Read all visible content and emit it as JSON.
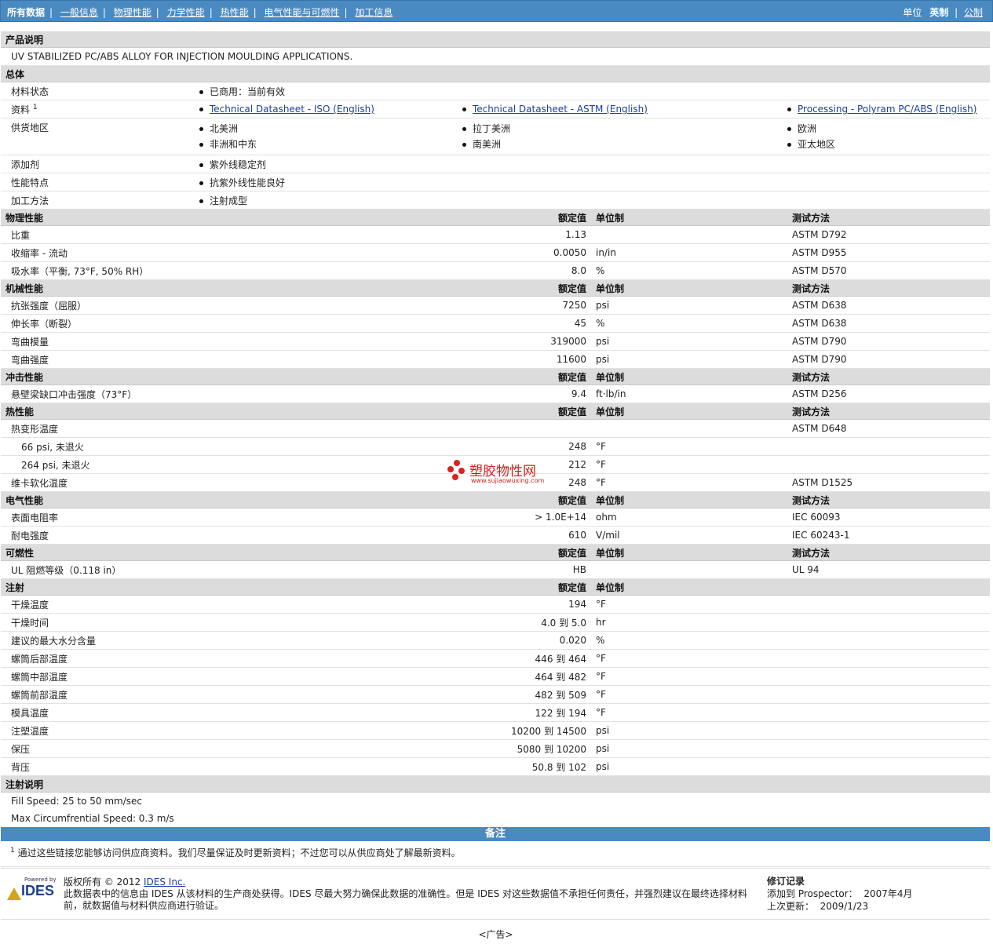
{
  "nav": {
    "tabs": [
      "所有数据",
      "一般信息",
      "物理性能",
      "力学性能",
      "热性能",
      "电气性能与可燃性",
      "加工信息"
    ],
    "units_label": "单位",
    "unit_active": "英制",
    "unit_other": "公制"
  },
  "product": {
    "heading": "产品说明",
    "description": "UV STABILIZED PC/ABS ALLOY FOR INJECTION MOULDING APPLICATIONS."
  },
  "general": {
    "heading": "总体",
    "status_label": "材料状态",
    "status_value": "已商用：当前有效",
    "docs_label": "资料",
    "docs_sup": "1",
    "docs": [
      "Technical Datasheet - ISO (English)",
      "Technical Datasheet - ASTM (English)",
      "Processing - Polyram PC/ABS (English)"
    ],
    "regions_label": "供货地区",
    "regions": [
      "北美洲",
      "拉丁美洲",
      "欧洲",
      "非洲和中东",
      "南美洲",
      "亚太地区"
    ],
    "additive_label": "添加剂",
    "additive_value": "紫外线稳定剂",
    "feature_label": "性能特点",
    "feature_value": "抗紫外线性能良好",
    "process_label": "加工方法",
    "process_value": "注射成型"
  },
  "col": {
    "value": "额定值",
    "unit": "单位制",
    "method": "测试方法"
  },
  "physical": {
    "heading": "物理性能",
    "rows": [
      {
        "label": "比重",
        "value": "1.13",
        "unit": "",
        "method": "ASTM D792"
      },
      {
        "label": "收缩率  - 流动",
        "value": "0.0050",
        "unit": "in/in",
        "method": "ASTM D955"
      },
      {
        "label": "吸水率（平衡, 73°F, 50% RH）",
        "value": "8.0",
        "unit": "%",
        "method": "ASTM D570"
      }
    ]
  },
  "mechanical": {
    "heading": "机械性能",
    "rows": [
      {
        "label": "抗张强度（屈服）",
        "value": "7250",
        "unit": "psi",
        "method": "ASTM D638"
      },
      {
        "label": "伸长率（断裂）",
        "value": "45",
        "unit": "%",
        "method": "ASTM D638"
      },
      {
        "label": "弯曲模量",
        "value": "319000",
        "unit": "psi",
        "method": "ASTM D790"
      },
      {
        "label": "弯曲强度",
        "value": "11600",
        "unit": "psi",
        "method": "ASTM D790"
      }
    ]
  },
  "impact": {
    "heading": "冲击性能",
    "rows": [
      {
        "label": "悬壁梁缺口冲击强度（73°F）",
        "value": "9.4",
        "unit": "ft·lb/in",
        "method": "ASTM D256"
      }
    ]
  },
  "thermal": {
    "heading": "热性能",
    "rows": [
      {
        "label": "热变形温度",
        "value": "",
        "unit": "",
        "method": "ASTM D648"
      },
      {
        "label": "66 psi, 未退火",
        "value": "248",
        "unit": "°F",
        "method": ""
      },
      {
        "label": "264 psi, 未退火",
        "value": "212",
        "unit": "°F",
        "method": ""
      },
      {
        "label": "维卡软化温度",
        "value": "248",
        "unit": "°F",
        "method": "ASTM D1525"
      }
    ]
  },
  "electrical": {
    "heading": "电气性能",
    "rows": [
      {
        "label": "表面电阻率",
        "value": "> 1.0E+14",
        "unit": "ohm",
        "method": "IEC 60093"
      },
      {
        "label": "耐电强度",
        "value": "610",
        "unit": "V/mil",
        "method": "IEC 60243-1"
      }
    ]
  },
  "flammability": {
    "heading": "可燃性",
    "rows": [
      {
        "label": "UL 阻燃等级（0.118 in）",
        "value": "HB",
        "unit": "",
        "method": "UL 94"
      }
    ]
  },
  "injection": {
    "heading": "注射",
    "rows": [
      {
        "label": "干燥温度",
        "value": "194",
        "unit": "°F"
      },
      {
        "label": "干燥时间",
        "value": "4.0 到  5.0",
        "unit": "hr"
      },
      {
        "label": "建议的最大水分含量",
        "value": "0.020",
        "unit": "%"
      },
      {
        "label": "螺筒后部温度",
        "value": "446 到  464",
        "unit": "°F"
      },
      {
        "label": "螺筒中部温度",
        "value": "464 到  482",
        "unit": "°F"
      },
      {
        "label": "螺筒前部温度",
        "value": "482 到  509",
        "unit": "°F"
      },
      {
        "label": "模具温度",
        "value": "122 到  194",
        "unit": "°F"
      },
      {
        "label": "注塑温度",
        "value": "10200 到  14500",
        "unit": "psi"
      },
      {
        "label": "保压",
        "value": "5080 到  10200",
        "unit": "psi"
      },
      {
        "label": "背压",
        "value": "50.8 到  102",
        "unit": "psi"
      }
    ]
  },
  "injection_notes": {
    "heading": "注射说明",
    "lines": [
      "Fill Speed: 25 to 50 mm/sec",
      "Max Circumfrential Speed: 0.3 m/s"
    ]
  },
  "notes": {
    "heading": "备注",
    "sup": "1",
    "text": "通过这些链接您能够访问供应商资料。我们尽量保证及时更新资料；不过您可以从供应商处了解最新资料。"
  },
  "footer": {
    "powered_by": "Powered by",
    "logo_text": "IDES",
    "copyright_prefix": "版权所有 © 2012",
    "company_link": "IDES Inc.",
    "disclaimer": "此数据表中的信息由 IDES 从该材料的生产商处获得。IDES 尽最大努力确保此数据的准确性。但是 IDES 对这些数据值不承担任何责任，并强烈建议在最终选择材料前，就数据值与材料供应商进行验证。",
    "revision_title": "修订记录",
    "added_label": "添加到 Prospector：",
    "added_value": "2007年4月",
    "updated_label": "上次更新：",
    "updated_value": "2009/1/23",
    "ad": "<广告>"
  },
  "watermark": {
    "title": "塑胶物性网",
    "url": "www.sujiaowuxing.com",
    "color": "#d81c1c"
  },
  "colors": {
    "nav_bg": "#4a8ac3",
    "section_bg": "#dcdcdc",
    "link": "#1a3fa0"
  }
}
